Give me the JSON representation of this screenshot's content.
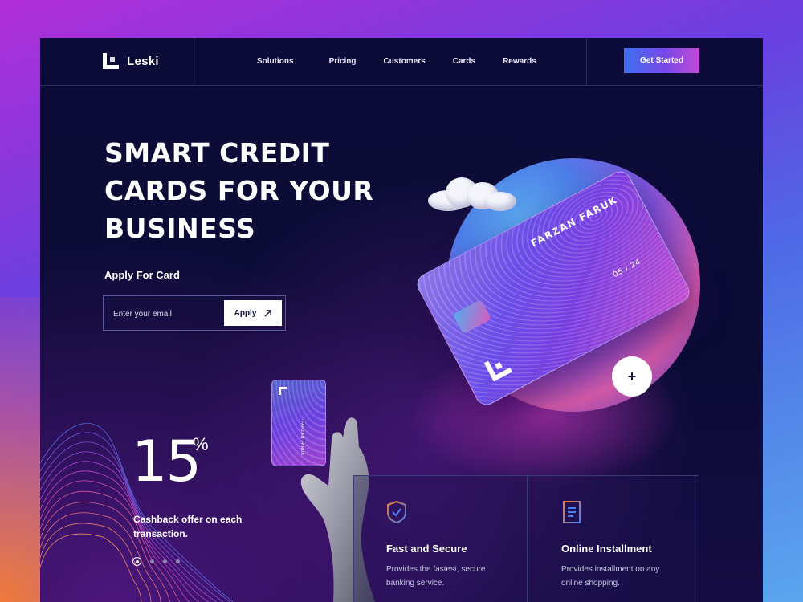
{
  "brand": {
    "name": "Leski"
  },
  "nav": {
    "items": [
      "Solutions",
      "Pricing",
      "Customers",
      "Cards",
      "Rewards"
    ],
    "cta_label": "Get Started"
  },
  "hero": {
    "title_lines": [
      "SMART CREDIT",
      "CARDS FOR YOUR",
      "BUSINESS"
    ],
    "apply_label": "Apply For Card",
    "email_placeholder": "Enter your email",
    "apply_button": "Apply",
    "apply_icon": "arrow-up-right-icon"
  },
  "card": {
    "holder_name": "FARZAN FARUK",
    "expiry": "05 / 24",
    "plus_label": "+"
  },
  "cashback": {
    "percent": "15",
    "symbol": "%",
    "text": "Cashback offer on each transaction.",
    "slide_count": 4,
    "active_slide": 0
  },
  "features": [
    {
      "icon": "shield-check-icon",
      "title": "Fast and Secure",
      "description": "Provides the fastest, secure banking service."
    },
    {
      "icon": "document-icon",
      "title": "Online Installment",
      "description": "Provides installment on any online shopping."
    }
  ],
  "colors": {
    "background": "#0c0b36",
    "accent_blue": "#3e6ff0",
    "accent_purple": "#7a48e8",
    "accent_pink": "#c04bd6"
  }
}
